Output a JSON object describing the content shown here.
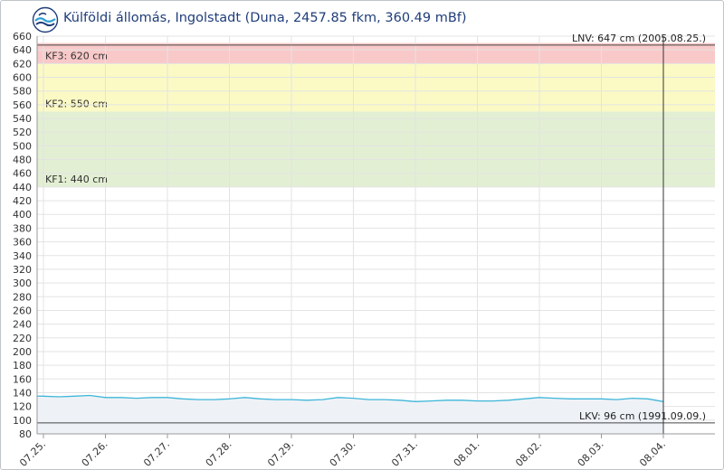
{
  "header": {
    "title": "Külföldi állomás, Ingolstadt (Duna, 2457.85 fkm, 360.49 mBf)",
    "logo_icon": "ovf-wave-logo-icon"
  },
  "colors": {
    "kf3_zone": "#f9c9c9",
    "kf2_zone": "#fbfac4",
    "kf1_zone": "#e3efd3",
    "series_line": "#3fb6d8",
    "series_fill": "#eef2f7",
    "grid": "#e3e3e3",
    "ref_line": "#444444",
    "title": "#1f3d7a"
  },
  "chart_data": {
    "type": "line",
    "title": "Külföldi állomás, Ingolstadt (Duna, 2457.85 fkm, 360.49 mBf)",
    "ylim": [
      80,
      660
    ],
    "ytick_step": 20,
    "xlim": [
      0,
      10.3
    ],
    "x_tick_labels": [
      "07.25.",
      "07.26.",
      "07.27.",
      "07.28.",
      "07.29.",
      "07.30.",
      "07.31.",
      "08.01.",
      "08.02.",
      "08.03.",
      "08.04."
    ],
    "grid": true,
    "zones": [
      {
        "label": "KF3: 620 cm",
        "from": 620,
        "to": 650
      },
      {
        "label": "KF2: 550 cm",
        "from": 550,
        "to": 620
      },
      {
        "label": "KF1: 440 cm",
        "from": 440,
        "to": 550
      }
    ],
    "reference_lines": [
      {
        "label": "LNV: 647 cm (2005.08.25.)",
        "value": 647
      },
      {
        "label": "LKV: 96 cm (1991.09.09.)",
        "value": 96
      }
    ],
    "current_time_marker_x": 10.0,
    "series": [
      {
        "x": [
          0,
          0.25,
          0.5,
          0.75,
          1.0,
          1.25,
          1.5,
          1.75,
          2.0,
          2.25,
          2.5,
          2.75,
          3.0,
          3.25,
          3.5,
          3.75,
          4.0,
          4.25,
          4.5,
          4.75,
          5.0,
          5.25,
          5.5,
          5.75,
          6.0,
          6.25,
          6.5,
          6.75,
          7.0,
          7.25,
          7.5,
          7.75,
          8.0,
          8.25,
          8.5,
          8.75,
          9.0,
          9.25,
          9.5,
          9.75,
          10.0
        ],
        "y": [
          135,
          134,
          135,
          136,
          133,
          133,
          132,
          133,
          133,
          131,
          130,
          130,
          131,
          133,
          131,
          130,
          130,
          129,
          130,
          133,
          132,
          130,
          130,
          129,
          127,
          128,
          129,
          129,
          128,
          128,
          129,
          131,
          133,
          132,
          131,
          131,
          131,
          130,
          132,
          131,
          127
        ]
      }
    ]
  }
}
